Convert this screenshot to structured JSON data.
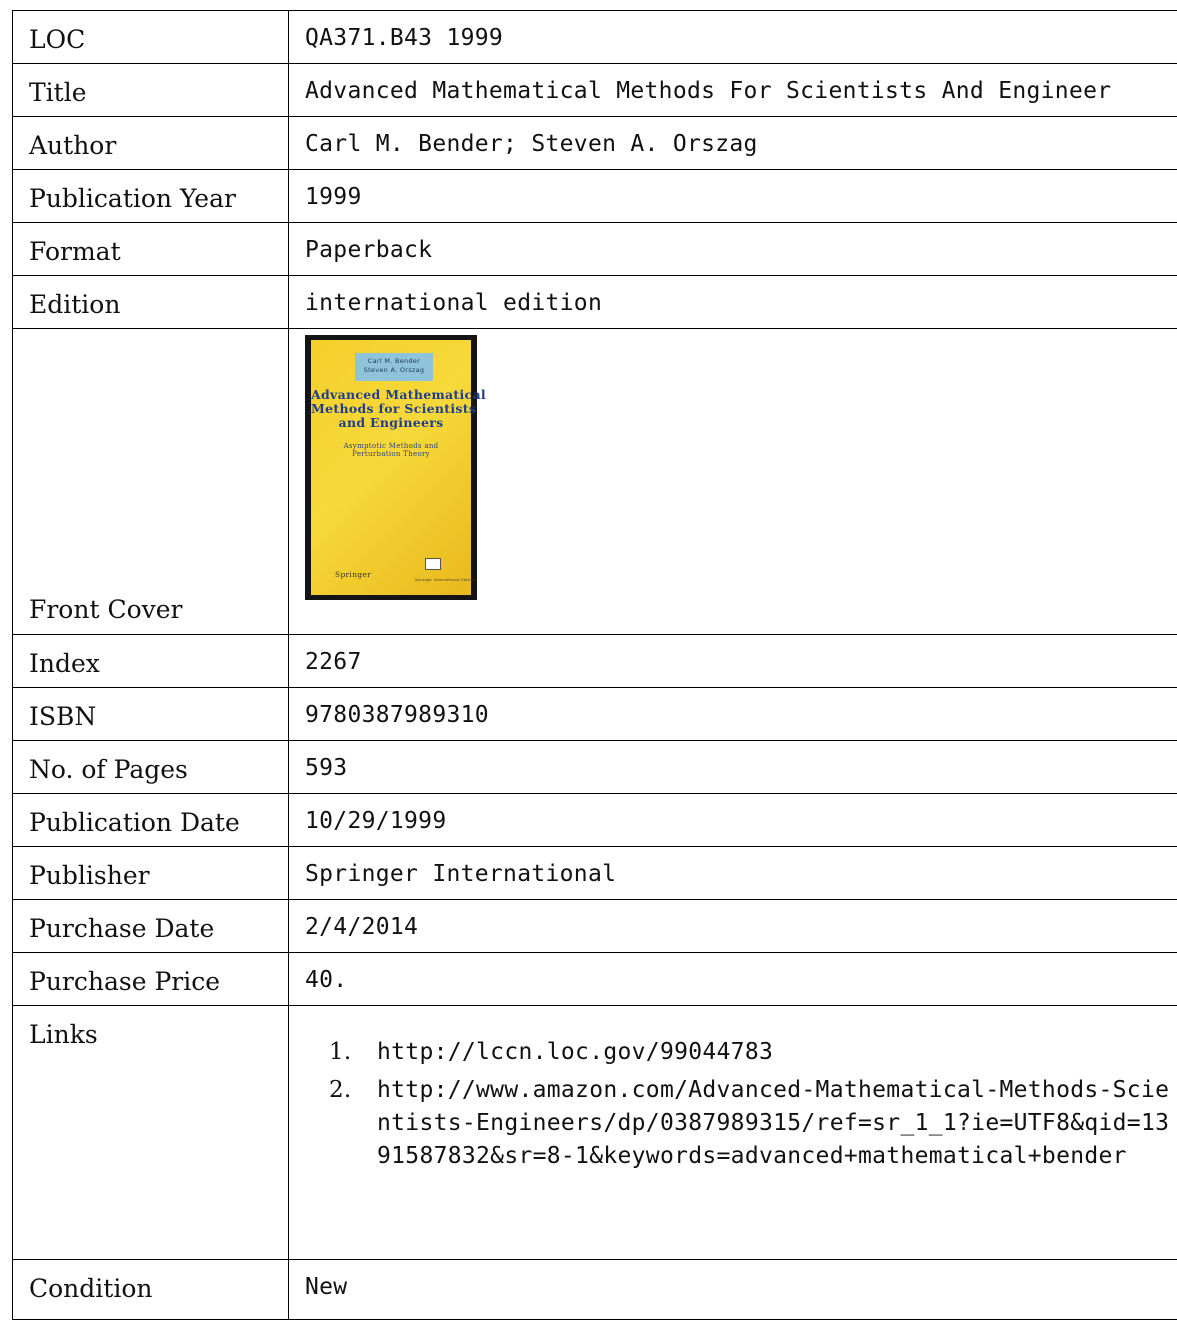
{
  "rows": [
    {
      "label": "LOC",
      "value": "QA371.B43 1999"
    },
    {
      "label": "Title",
      "value": "Advanced Mathematical Methods For Scientists And Engineer"
    },
    {
      "label": "Author",
      "value": "Carl M. Bender; Steven A. Orszag"
    },
    {
      "label": "Publication Year",
      "value": "1999"
    },
    {
      "label": "Format",
      "value": "Paperback"
    },
    {
      "label": "Edition",
      "value": "international edition"
    }
  ],
  "cover": {
    "label": "Front Cover",
    "authors_line1": "Carl M. Bender",
    "authors_line2": "Steven A. Orszag",
    "title_line1": "Advanced Mathematical",
    "title_line2": "Methods for Scientists",
    "title_line3": "and Engineers",
    "subtitle_line1": "Asymptotic Methods and",
    "subtitle_line2": "Perturbation Theory",
    "publisher_mark": "Springer",
    "edition_mark": "Springer International Edition"
  },
  "rows2": [
    {
      "label": "Index",
      "value": "2267"
    },
    {
      "label": "ISBN",
      "value": "9780387989310"
    },
    {
      "label": "No. of Pages",
      "value": "593"
    },
    {
      "label": "Publication Date",
      "value": "10/29/1999"
    },
    {
      "label": "Publisher",
      "value": "Springer International"
    },
    {
      "label": "Purchase Date",
      "value": "2/4/2014"
    },
    {
      "label": "Purchase Price",
      "value": "40."
    }
  ],
  "links": {
    "label": "Links",
    "items": [
      {
        "num": "1.",
        "url": "http://lccn.loc.gov/99044783"
      },
      {
        "num": "2.",
        "url": "http://www.amazon.com/Advanced-Mathematical-Methods-Scientists-Engineers/dp/0387989315/ref=sr_1_1?ie=UTF8&qid=1391587832&sr=8-1&keywords=advanced+mathematical+bender"
      }
    ]
  },
  "condition": {
    "label": "Condition",
    "value": "New"
  }
}
